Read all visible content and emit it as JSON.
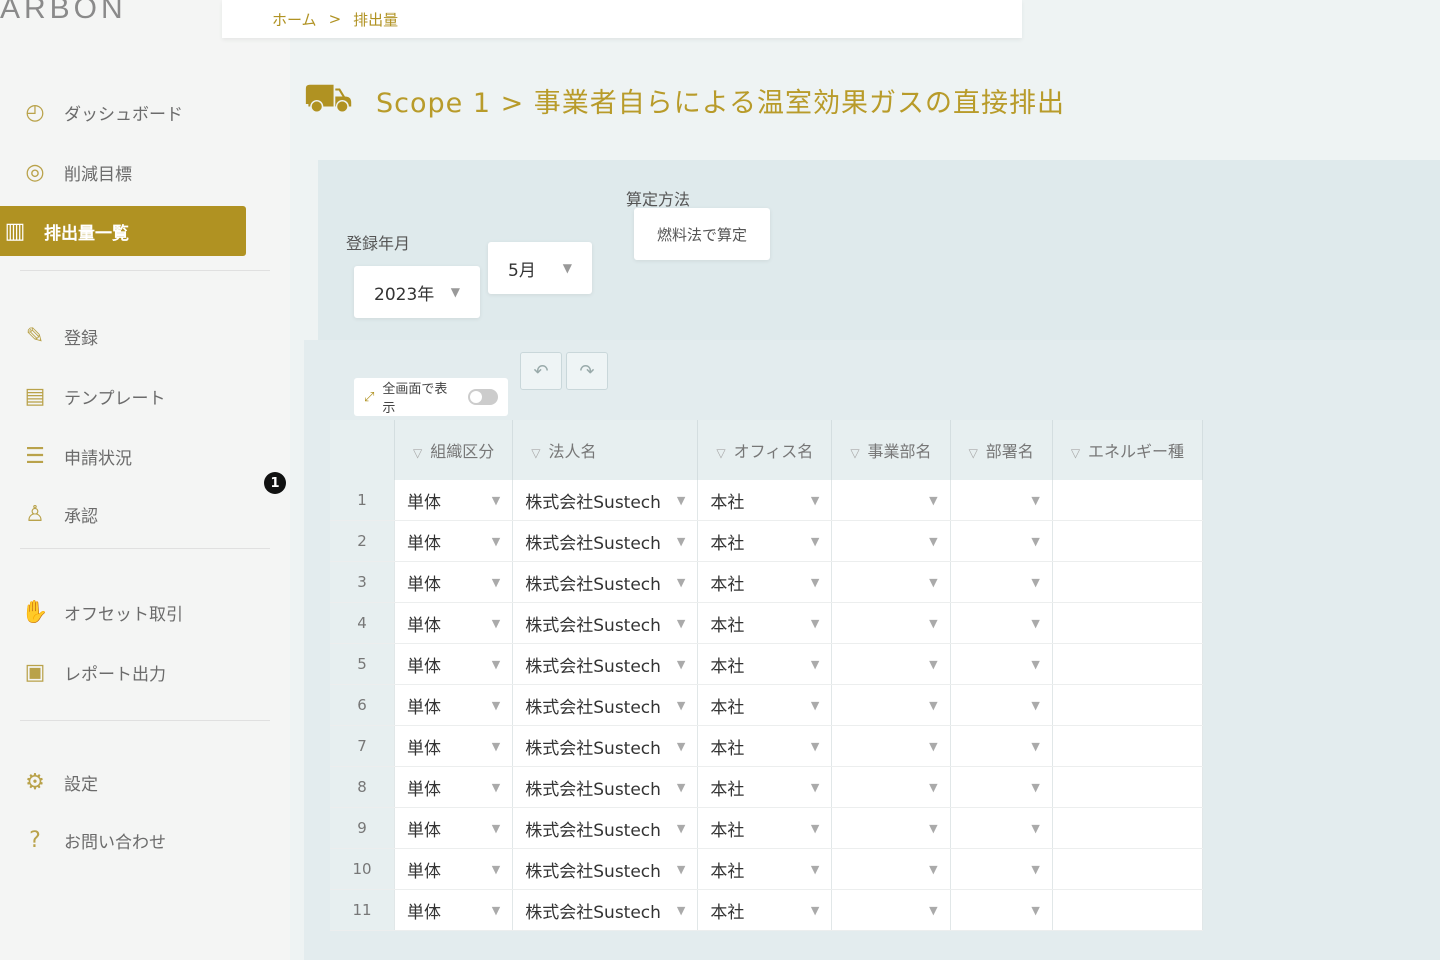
{
  "brand": "ARBON",
  "breadcrumb": [
    "ホーム",
    ">",
    "排出量"
  ],
  "sidebar": {
    "items": [
      {
        "label": "ダッシュボード",
        "icon": "dashboard-icon"
      },
      {
        "label": "削減目標",
        "icon": "target-icon"
      },
      {
        "label": "排出量一覧",
        "icon": "list-icon",
        "active": true
      },
      {
        "label": "登録",
        "icon": "pencil-icon"
      },
      {
        "label": "テンプレート",
        "icon": "template-icon"
      },
      {
        "label": "申請状況",
        "icon": "status-icon"
      },
      {
        "label": "承認",
        "icon": "approver-icon",
        "badge": "1"
      },
      {
        "label": "オフセット取引",
        "icon": "handshake-icon"
      },
      {
        "label": "レポート出力",
        "icon": "report-icon"
      },
      {
        "label": "設定",
        "icon": "gear-icon"
      },
      {
        "label": "お問い合わせ",
        "icon": "question-icon"
      }
    ]
  },
  "page": {
    "title": "Scope 1 > 事業者自らによる温室効果ガスの直接排出"
  },
  "filters": {
    "period_label": "登録年月",
    "year": "2023年",
    "month": "5月",
    "method_label": "算定方法",
    "method_button": "燃料法で算定"
  },
  "grid": {
    "fullscreen_label": "全画面で表示",
    "columns": [
      "組織区分",
      "法人名",
      "オフィス名",
      "事業部名",
      "部署名",
      "エネルギー種"
    ],
    "rows": [
      {
        "no": "1",
        "org": "単体",
        "corp": "株式会社Sustech",
        "office": "本社"
      },
      {
        "no": "2",
        "org": "単体",
        "corp": "株式会社Sustech",
        "office": "本社"
      },
      {
        "no": "3",
        "org": "単体",
        "corp": "株式会社Sustech",
        "office": "本社"
      },
      {
        "no": "4",
        "org": "単体",
        "corp": "株式会社Sustech",
        "office": "本社"
      },
      {
        "no": "5",
        "org": "単体",
        "corp": "株式会社Sustech",
        "office": "本社"
      },
      {
        "no": "6",
        "org": "単体",
        "corp": "株式会社Sustech",
        "office": "本社"
      },
      {
        "no": "7",
        "org": "単体",
        "corp": "株式会社Sustech",
        "office": "本社"
      },
      {
        "no": "8",
        "org": "単体",
        "corp": "株式会社Sustech",
        "office": "本社"
      },
      {
        "no": "9",
        "org": "単体",
        "corp": "株式会社Sustech",
        "office": "本社"
      },
      {
        "no": "10",
        "org": "単体",
        "corp": "株式会社Sustech",
        "office": "本社"
      },
      {
        "no": "11",
        "org": "単体",
        "corp": "株式会社Sustech",
        "office": "本社"
      }
    ]
  },
  "colors": {
    "accent": "#b09222",
    "panel": "#dfeaec"
  }
}
